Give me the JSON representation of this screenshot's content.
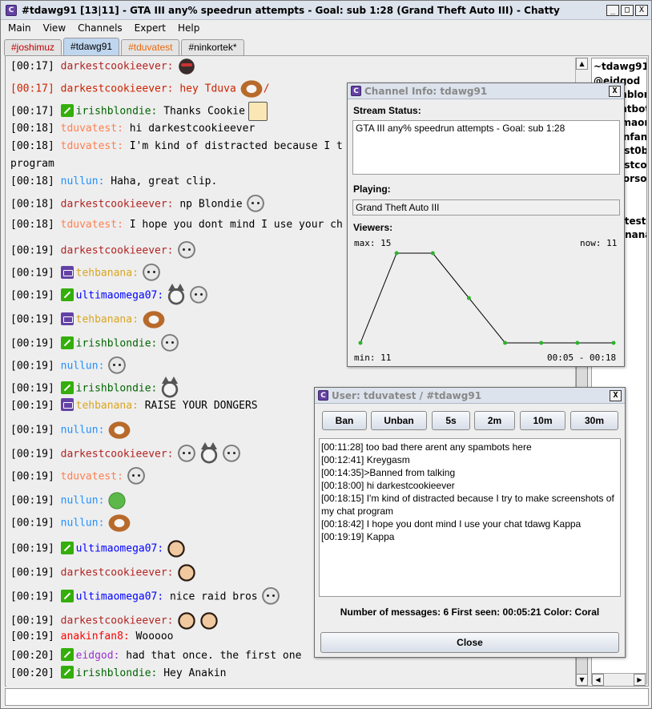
{
  "window": {
    "title": "#tdawg91 [13|11] - GTA III any% speedrun attempts - Goal: sub 1:28 (Grand Theft Auto III) - Chatty",
    "buttons": [
      "_",
      "□",
      "X"
    ]
  },
  "menu": [
    {
      "label": "Main"
    },
    {
      "label": "View"
    },
    {
      "label": "Channels"
    },
    {
      "label": "Expert"
    },
    {
      "label": "Help"
    }
  ],
  "tabs": [
    {
      "label": "#joshimuz",
      "color": "#C00000"
    },
    {
      "label": "#tdawg91",
      "color": "#000000",
      "active": true
    },
    {
      "label": "#tduvatest",
      "color": "#E86A10"
    },
    {
      "label": "#ninkortek*",
      "color": "#000000"
    }
  ],
  "colors": {
    "darkestcookieever": "#B22222",
    "irishblondie": "#006400",
    "tduvatest": "#FF7F50",
    "nullun": "#1E90FF",
    "tehbanana": "#DAA520",
    "ultimaomega07": "#0000FF",
    "anakinfan8": "#FF0000",
    "eidgod": "#9932CC"
  },
  "chat": [
    {
      "time": "[00:17]",
      "user": "darkestcookieever",
      "text": "",
      "emotes": [
        "dark"
      ]
    },
    {
      "time": "[00:17]",
      "user": "darkestcookieever",
      "text": "hey Tduva",
      "emotes": [
        "dog"
      ],
      "suffix": "/",
      "highlight": true
    },
    {
      "time": "[00:17]",
      "badge": "mod",
      "user": "irishblondie",
      "text": "Thanks Cookie",
      "emotes": [
        "sq"
      ]
    },
    {
      "time": "[00:18]",
      "user": "tduvatest",
      "text": "hi darkestcookieever",
      "emotes": []
    },
    {
      "time": "[00:18]",
      "user": "tduvatest",
      "text": "I'm kind of distracted because I t",
      "emotes": []
    },
    {
      "time": "",
      "user": "",
      "text": "program",
      "emotes": [],
      "wrap": true
    },
    {
      "time": "[00:18]",
      "user": "nullun",
      "text": "Haha, great clip.",
      "emotes": []
    },
    {
      "time": "[00:18]",
      "user": "darkestcookieever",
      "text": "np Blondie",
      "emotes": [
        "face"
      ]
    },
    {
      "time": "[00:18]",
      "user": "tduvatest",
      "text": "I hope you dont mind I use your ch",
      "emotes": []
    },
    {
      "time": "[00:19]",
      "user": "darkestcookieever",
      "text": "",
      "emotes": [
        "face"
      ]
    },
    {
      "time": "[00:19]",
      "badge": "sub",
      "user": "tehbanana",
      "text": "",
      "emotes": [
        "face"
      ]
    },
    {
      "time": "[00:19]",
      "badge": "mod",
      "user": "ultimaomega07",
      "text": "",
      "emotes": [
        "cat",
        "face"
      ]
    },
    {
      "time": "[00:19]",
      "badge": "sub",
      "user": "tehbanana",
      "text": "",
      "emotes": [
        "dog"
      ]
    },
    {
      "time": "[00:19]",
      "badge": "mod",
      "user": "irishblondie",
      "text": "",
      "emotes": [
        "face"
      ]
    },
    {
      "time": "[00:19]",
      "user": "nullun",
      "text": "",
      "emotes": [
        "face"
      ]
    },
    {
      "time": "[00:19]",
      "badge": "mod",
      "user": "irishblondie",
      "text": "",
      "emotes": [
        "cat"
      ]
    },
    {
      "time": "[00:19]",
      "badge": "sub",
      "user": "tehbanana",
      "text": "RAISE YOUR DONGERS",
      "emotes": []
    },
    {
      "time": "[00:19]",
      "user": "nullun",
      "text": "",
      "emotes": [
        "dog"
      ]
    },
    {
      "time": "[00:19]",
      "user": "darkestcookieever",
      "text": "",
      "emotes": [
        "face",
        "cat",
        "face"
      ]
    },
    {
      "time": "[00:19]",
      "user": "tduvatest",
      "text": "",
      "emotes": [
        "face"
      ]
    },
    {
      "time": "[00:19]",
      "user": "nullun",
      "text": "",
      "emotes": [
        "frog"
      ]
    },
    {
      "time": "[00:19]",
      "user": "nullun",
      "text": "",
      "emotes": [
        "dog"
      ]
    },
    {
      "time": "[00:19]",
      "badge": "mod",
      "user": "ultimaomega07",
      "text": "",
      "emotes": [
        "wow"
      ]
    },
    {
      "time": "[00:19]",
      "user": "darkestcookieever",
      "text": "",
      "emotes": [
        "wow"
      ]
    },
    {
      "time": "[00:19]",
      "badge": "mod",
      "user": "ultimaomega07",
      "text": "nice raid bros",
      "emotes": [
        "face"
      ]
    },
    {
      "time": "[00:19]",
      "user": "darkestcookieever",
      "text": "",
      "emotes": [
        "wow",
        "wow"
      ]
    },
    {
      "time": "[00:19]",
      "user": "anakinfan8",
      "text": "Wooooo",
      "emotes": []
    },
    {
      "time": "[00:20]",
      "badge": "mod",
      "user": "eidgod",
      "text": "had that once. the first one",
      "emotes": []
    },
    {
      "time": "[00:20]",
      "badge": "mod",
      "user": "irishblondie",
      "text": "Hey Anakin",
      "emotes": []
    }
  ],
  "userlist": [
    "~tdawg91",
    "@eidgod",
    "@irishblond",
    "@nightbot",
    "@ultimaom",
    "anakinfan8",
    "darkest0bb",
    "darkestcoo",
    "nerdtorsor",
    "",
    "",
    "tduvatest",
    "tehbanana"
  ],
  "channel_info": {
    "title": "Channel Info: tdawg91",
    "stream_status_label": "Stream Status:",
    "stream_status": "GTA III any% speedrun attempts - Goal: sub 1:28",
    "playing_label": "Playing:",
    "playing": "Grand Theft Auto III",
    "viewers_label": "Viewers:",
    "max_label": "max: 15",
    "now_label": "now: 11",
    "min_label": "min: 11",
    "range_label": "00:05 - 00:18",
    "close_symbol": "X"
  },
  "chart_data": {
    "type": "line",
    "series": [
      {
        "values": [
          11,
          15,
          15,
          13,
          11,
          11,
          11,
          11
        ]
      }
    ],
    "ylim": [
      11,
      15
    ]
  },
  "user_dialog": {
    "title": "User: tduvatest / #tdawg91",
    "buttons": [
      "Ban",
      "Unban",
      "5s",
      "2m",
      "10m",
      "30m"
    ],
    "messages": [
      "[00:11:28] too bad there arent any spambots here",
      "[00:12:41] Kreygasm",
      "[00:14:35]>Banned from talking",
      "[00:18:00] hi darkestcookieever",
      "[00:18:15] I'm kind of distracted because I try to make screenshots of my chat program",
      "[00:18:42] I hope you dont mind I use your chat tdawg Kappa",
      "[00:19:19] Kappa"
    ],
    "info": "Number of messages: 6  First seen: 00:05:21  Color: Coral",
    "close_label": "Close",
    "close_symbol": "X"
  }
}
